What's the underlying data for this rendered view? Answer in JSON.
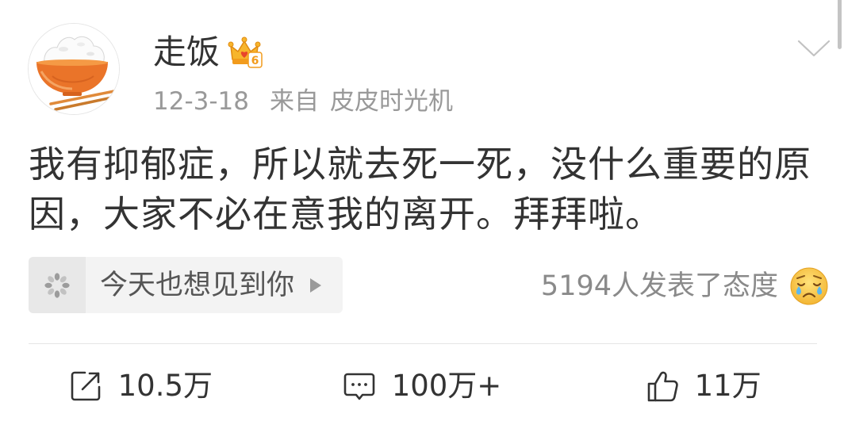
{
  "post": {
    "author": {
      "name": "走饭",
      "avatar_icon": "rice-bowl-avatar",
      "badge": {
        "icon": "vip-crown-icon",
        "level": "6"
      }
    },
    "meta": {
      "time": "12-3-18",
      "source_prefix": "来自",
      "source_name": "皮皮时光机"
    },
    "menu_icon": "chevron-down-icon",
    "text": "我有抑郁症，所以就去死一死，没什么重要的原因，大家不必在意我的离开。拜拜啦。"
  },
  "topic": {
    "icon": "pinwheel-icon",
    "label": "今天也想见到你",
    "arrow_icon": "play-triangle-icon"
  },
  "reactions": {
    "text": "5194人发表了态度",
    "emoji_icon": "crying-face-icon"
  },
  "actions": [
    {
      "icon": "repost-icon",
      "count": "10.5万"
    },
    {
      "icon": "comment-icon",
      "count": "100万+"
    },
    {
      "icon": "like-icon",
      "count": "11万"
    }
  ],
  "theme": {
    "text": "#333333",
    "muted": "#999999",
    "muted_dark": "#8a8a8a",
    "topic_bg": "#f3f3f3",
    "divider": "#e5e5e5",
    "badge_gold": "#f7b52c"
  }
}
